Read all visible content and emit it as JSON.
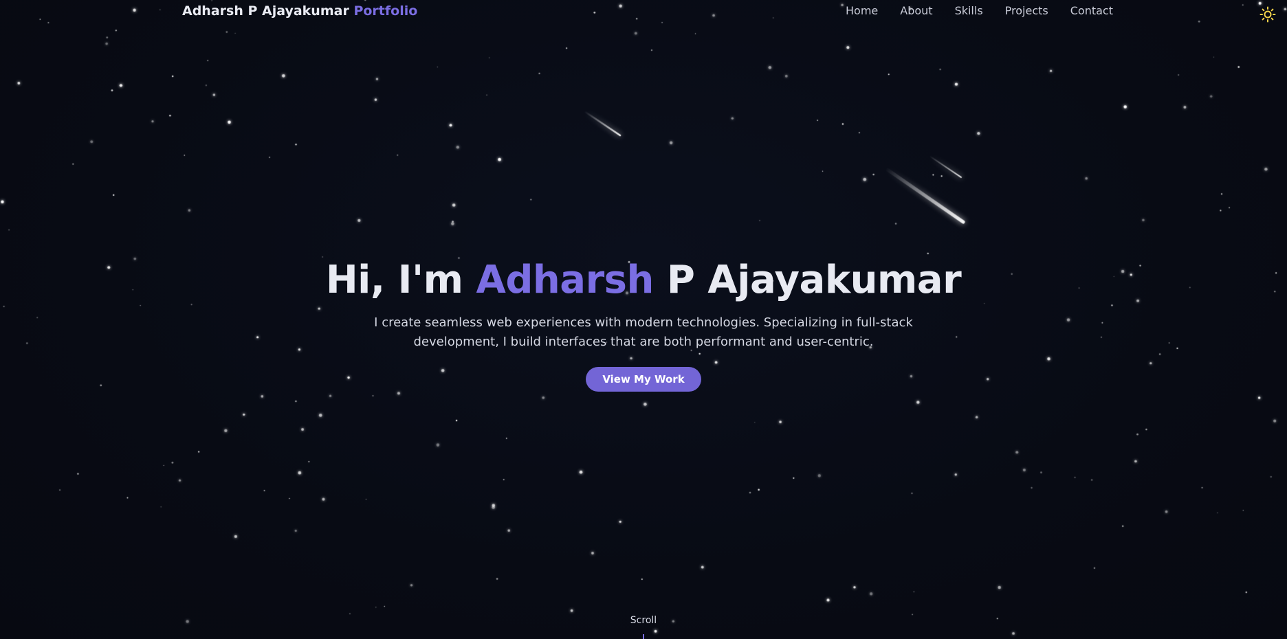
{
  "nav": {
    "brand_name": "Adharsh P Ajayakumar",
    "brand_accent": "Portfolio",
    "links": [
      {
        "label": "Home"
      },
      {
        "label": "About"
      },
      {
        "label": "Skills"
      },
      {
        "label": "Projects"
      },
      {
        "label": "Contact"
      }
    ],
    "theme_toggle_icon": "sun-icon"
  },
  "hero": {
    "title_prefix": "Hi, I'm ",
    "title_accent": "Adharsh",
    "title_suffix": " P Ajayakumar",
    "subtitle": "I create seamless web experiences with modern technologies. Specializing in full-stack development, I build interfaces that are both performant and user-centric.",
    "cta_label": "View My Work"
  },
  "scroll": {
    "label": "Scroll"
  },
  "colors": {
    "background": "#080b14",
    "accent": "#7b6ee3",
    "button": "#7365d6",
    "sun": "#f4d44a"
  }
}
